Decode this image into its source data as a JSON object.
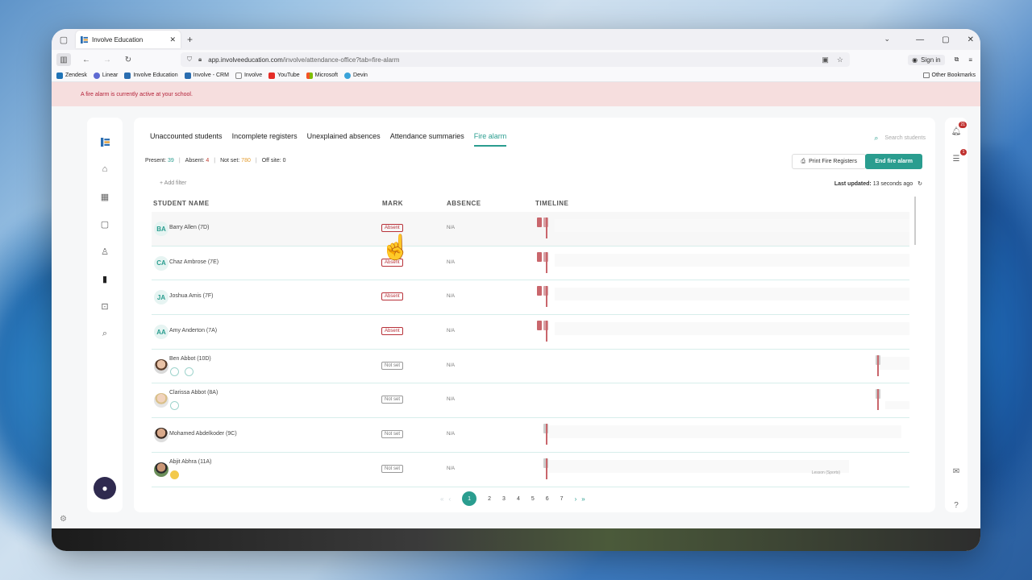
{
  "browser": {
    "tab_title": "Involve Education",
    "url_domain": "app.involveeducation.com",
    "url_path": "/involve/attendance-office?tab=fire-alarm",
    "sign_in": "Sign in",
    "bookmarks": [
      {
        "label": "Zendesk",
        "color": "#1f73b7"
      },
      {
        "label": "Linear",
        "color": "#5e6ad2"
      },
      {
        "label": "Involve Education",
        "color": "#2a6db0"
      },
      {
        "label": "Involve - CRM",
        "color": "#2a6db0"
      },
      {
        "label": "Involve",
        "color": "#888888"
      },
      {
        "label": "YouTube",
        "color": "#e52d27"
      },
      {
        "label": "Microsoft",
        "color": "#f35325"
      },
      {
        "label": "Devin",
        "color": "#3aa3d9"
      }
    ],
    "other_bookmarks": "Other Bookmarks"
  },
  "alert": "A fire alarm is currently active at your school.",
  "tabs": [
    "Unaccounted students",
    "Incomplete registers",
    "Unexplained absences",
    "Attendance summaries",
    "Fire alarm"
  ],
  "active_tab": "Fire alarm",
  "search_placeholder": "Search students",
  "stats": {
    "present_label": "Present:",
    "present": "39",
    "absent_label": "Absent:",
    "absent": "4",
    "notset_label": "Not set:",
    "notset": "780",
    "offsite_label": "Off site:",
    "offsite": "0"
  },
  "buttons": {
    "print": "Print Fire Registers",
    "end": "End fire alarm"
  },
  "add_filter": "+ Add filter",
  "last_updated_label": "Last updated:",
  "last_updated_value": "13 seconds ago",
  "columns": [
    "STUDENT NAME",
    "MARK",
    "ABSENCE",
    "TIMELINE"
  ],
  "students": [
    {
      "initials": "BA",
      "name": "Barry Allen (7D)",
      "mark": "Absent",
      "absence": "N/A"
    },
    {
      "initials": "CA",
      "name": "Chaz Ambrose (7E)",
      "mark": "Absent",
      "absence": "N/A"
    },
    {
      "initials": "JA",
      "name": "Joshua Amis (7F)",
      "mark": "Absent",
      "absence": "N/A"
    },
    {
      "initials": "AA",
      "name": "Amy Anderton (7A)",
      "mark": "Absent",
      "absence": "N/A"
    },
    {
      "initials": "",
      "name": "Ben Abbot (10D)",
      "mark": "Not set",
      "absence": "N/A"
    },
    {
      "initials": "",
      "name": "Clarissa Abbot (8A)",
      "mark": "Not set",
      "absence": "N/A"
    },
    {
      "initials": "",
      "name": "Mohamed Abdelkoder (9C)",
      "mark": "Not set",
      "absence": "N/A"
    },
    {
      "initials": "",
      "name": "Abjit Abhra (11A)",
      "mark": "Not set",
      "absence": "N/A"
    }
  ],
  "timeline_lesson_label": "Lesson (Sports)",
  "pagination": [
    "1",
    "2",
    "3",
    "4",
    "5",
    "6",
    "7"
  ],
  "current_page": "1",
  "notification_count": "21",
  "tasks_count": "1",
  "colors": {
    "accent": "#2a9d8f",
    "absent": "#b8323a",
    "alert_bg": "#f6dede"
  }
}
